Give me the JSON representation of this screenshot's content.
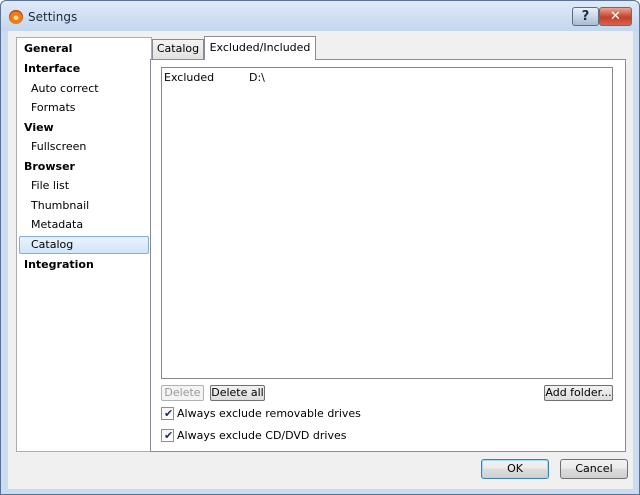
{
  "window": {
    "title": "Settings",
    "help_label": "?",
    "close_label": "✕"
  },
  "sidebar": {
    "items": [
      {
        "label": "General",
        "group": true
      },
      {
        "label": "Interface",
        "group": true
      },
      {
        "label": "Auto correct",
        "group": false
      },
      {
        "label": "Formats",
        "group": false
      },
      {
        "label": "View",
        "group": true
      },
      {
        "label": "Fullscreen",
        "group": false
      },
      {
        "label": "Browser",
        "group": true
      },
      {
        "label": "File list",
        "group": false
      },
      {
        "label": "Thumbnail",
        "group": false
      },
      {
        "label": "Metadata",
        "group": false
      },
      {
        "label": "Catalog",
        "group": false,
        "selected": true
      },
      {
        "label": "Integration",
        "group": true
      }
    ]
  },
  "tabs": {
    "catalog": "Catalog",
    "excluded_included": "Excluded/Included",
    "active": "excluded_included"
  },
  "list": {
    "rows": [
      {
        "status": "Excluded",
        "path": "D:\\"
      }
    ]
  },
  "buttons": {
    "delete": "Delete",
    "delete_all": "Delete all",
    "add_folder": "Add folder..."
  },
  "options": {
    "exclude_removable": {
      "label": "Always exclude removable drives",
      "checked": true
    },
    "exclude_cd_dvd": {
      "label": "Always exclude CD/DVD drives",
      "checked": true
    }
  },
  "dialog": {
    "ok": "OK",
    "cancel": "Cancel"
  }
}
